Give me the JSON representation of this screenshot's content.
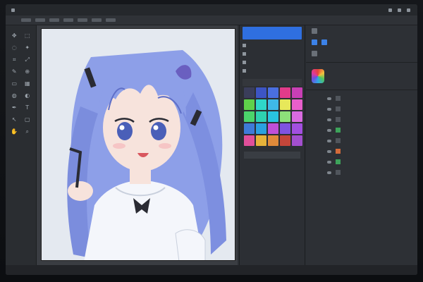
{
  "menubar": {
    "items": [
      "",
      "",
      "",
      "",
      ""
    ]
  },
  "toolbar": {
    "tools": [
      {
        "icon": "move-icon",
        "glyph": "✥"
      },
      {
        "icon": "marquee-icon",
        "glyph": "⬚"
      },
      {
        "icon": "lasso-icon",
        "glyph": "◌"
      },
      {
        "icon": "wand-icon",
        "glyph": "✦"
      },
      {
        "icon": "crop-icon",
        "glyph": "⌗"
      },
      {
        "icon": "eyedropper-icon",
        "glyph": "⤢"
      },
      {
        "icon": "brush-icon",
        "glyph": "✎"
      },
      {
        "icon": "stamp-icon",
        "glyph": "⊕"
      },
      {
        "icon": "eraser-icon",
        "glyph": "▭"
      },
      {
        "icon": "gradient-icon",
        "glyph": "▦"
      },
      {
        "icon": "blur-icon",
        "glyph": "◍"
      },
      {
        "icon": "dodge-icon",
        "glyph": "◐"
      },
      {
        "icon": "pen-icon",
        "glyph": "✒"
      },
      {
        "icon": "text-icon",
        "glyph": "T"
      },
      {
        "icon": "path-icon",
        "glyph": "↖"
      },
      {
        "icon": "shape-icon",
        "glyph": "▢"
      },
      {
        "icon": "hand-icon",
        "glyph": "✋"
      },
      {
        "icon": "zoom-icon",
        "glyph": "⌕"
      }
    ]
  },
  "midpanel": {
    "selected_item": "",
    "list": [
      "",
      "",
      "",
      ""
    ],
    "swatch_header": "",
    "swatches": [
      "#3a3d5a",
      "#3d55c4",
      "#4a6fe0",
      "#e23b8a",
      "#c93fb5",
      "#5fd14a",
      "#2fd7c9",
      "#3fb9e8",
      "#e7e85a",
      "#e85fcb",
      "#4bd46b",
      "#2ed1b0",
      "#29c4e0",
      "#8de07a",
      "#d96be0",
      "#3e7bd8",
      "#2aa1e0",
      "#c04fd8",
      "#7f53e0",
      "#a34fe0",
      "#e04f9a",
      "#e6b23a",
      "#e08a3a",
      "#c4463a",
      "#a34fcf"
    ],
    "button_label": ""
  },
  "rightpanel": {
    "rows": [
      "",
      "",
      ""
    ],
    "layers": [
      "",
      "",
      "",
      "",
      "",
      "",
      "",
      ""
    ]
  },
  "canvas": {
    "subject": "anime-girl-illustration",
    "colors": {
      "hair": "#8d9fe8",
      "hair_shadow": "#5f6fc8",
      "skin": "#f7e3dc",
      "dress": "#f4f6fb",
      "eye": "#4a5fb8",
      "ribbon": "#2a2b33",
      "bg": "#e4e9f0"
    }
  },
  "statusbar": {
    "text": ""
  }
}
